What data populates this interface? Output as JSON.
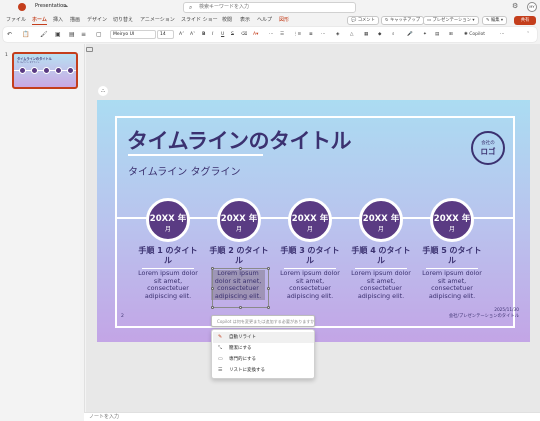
{
  "titlebar": {
    "doc_title": "Presentation",
    "search_placeholder": "検索キーワードを入力",
    "avatar_initials": "MY"
  },
  "menu": {
    "items": [
      "ファイル",
      "ホーム",
      "挿入",
      "描画",
      "デザイン",
      "切り替え",
      "アニメーション",
      "スライド ショー",
      "校閲",
      "表示",
      "ヘルプ",
      "図形"
    ],
    "active": "ホーム",
    "comment_label": "コメント",
    "catchup_label": "キャッチアップ",
    "present_label": "プレゼンテーション",
    "edit_label": "編集",
    "share_label": "共有"
  },
  "ribbon": {
    "font_name": "Meiryo UI",
    "font_size": "14",
    "copilot_label": "Copilot"
  },
  "thumbnail": {
    "number": "1",
    "title": "タイムラインのタイトル",
    "subtitle": "タイムライン タグライン"
  },
  "slide": {
    "title": "タイムラインのタイトル",
    "subtitle": "タイムライン タグライン",
    "logo_small": "会社の",
    "logo_big": "ロゴ",
    "slide_number": "2",
    "footer_date": "2025/11/30",
    "footer_text": "会社/プレゼンテーションのタイトル",
    "milestones": [
      {
        "year": "20XX 年",
        "month": "月",
        "step": "手順 1 のタイトル",
        "body": "Lorem ipsum dolor sit amet, consectetuer adipiscing elit."
      },
      {
        "year": "20XX 年",
        "month": "月",
        "step": "手順 2 のタイトル",
        "body": "Lorem ipsum dolor sit amet, consectetuer adipiscing elit."
      },
      {
        "year": "20XX 年",
        "month": "月",
        "step": "手順 3 のタイトル",
        "body": "Lorem ipsum dolor sit amet, consectetuer adipiscing elit."
      },
      {
        "year": "20XX 年",
        "month": "月",
        "step": "手順 4 のタイトル",
        "body": "Lorem ipsum dolor sit amet, consectetuer adipiscing elit."
      },
      {
        "year": "20XX 年",
        "month": "月",
        "step": "手順 5 のタイトル",
        "body": "Lorem ipsum dolor sit amet, consectetuer adipiscing elit."
      }
    ]
  },
  "copilot": {
    "placeholder": "Copilot は何を変更または追加する必要がありますか?",
    "menu_items": [
      "自動リライト",
      "簡潔にする",
      "専門的にする",
      "リストに変換する"
    ]
  },
  "notes": {
    "placeholder": "ノートを入力"
  },
  "colors": {
    "accent": "#c43e1c",
    "slide_text": "#3b3170",
    "milestone_fill": "#5a3b83"
  }
}
